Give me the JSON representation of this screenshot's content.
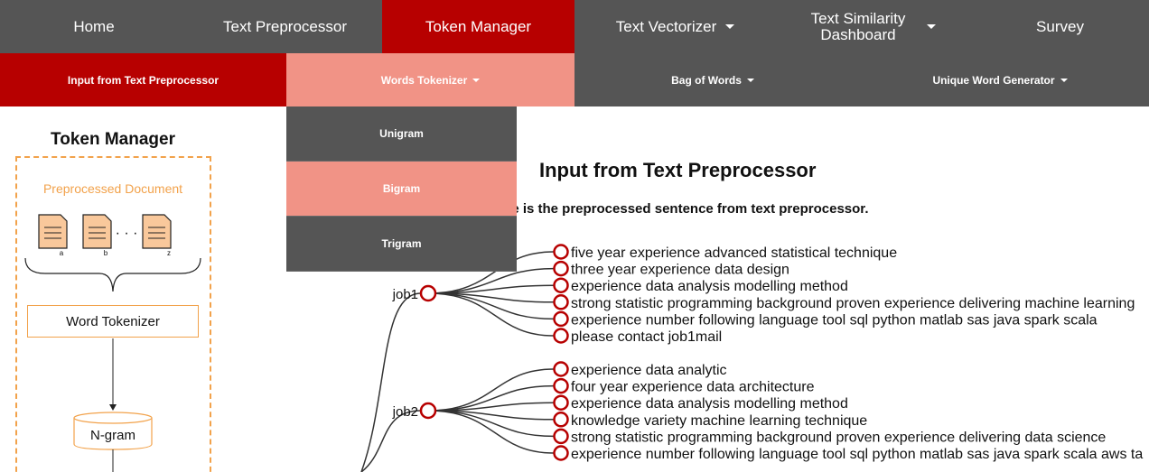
{
  "topnav": {
    "items": [
      {
        "label": "Home"
      },
      {
        "label": "Text Preprocessor"
      },
      {
        "label": "Token Manager"
      },
      {
        "label": "Text Vectorizer"
      },
      {
        "label_line1": "Text Similarity",
        "label_line2": "Dashboard"
      },
      {
        "label": "Survey"
      }
    ],
    "active_color": "#b70000",
    "bg_color": "#555555"
  },
  "subnav": {
    "items": [
      {
        "label": "Input from Text Preprocessor"
      },
      {
        "label": "Words Tokenizer"
      },
      {
        "label": "Bag of Words"
      },
      {
        "label": "Unique Word Generator"
      }
    ],
    "hover_color": "#f19386"
  },
  "dropdown": {
    "items": [
      {
        "label": "Unigram"
      },
      {
        "label": "Bigram"
      },
      {
        "label": "Trigram"
      }
    ]
  },
  "diagram": {
    "title": "Token Manager",
    "preprocessed_label": "Preprocessed Document",
    "doc_labels": [
      "a",
      "b",
      "z"
    ],
    "ellipsis": "· · ·",
    "word_tokenizer": "Word Tokenizer",
    "ngram": "N-gram",
    "accent_color": "#f2a24b"
  },
  "content": {
    "title": "Input from Text Preprocessor",
    "subtitle": "ode is the preprocessed sentence from text preprocessor."
  },
  "tree": {
    "node_color": "#b70000",
    "groups": [
      {
        "label": "job1",
        "leaves": [
          "five year experience advanced statistical technique",
          "three year experience data design",
          "experience data analysis modelling method",
          "strong statistic programming background proven experience delivering machine learning",
          "experience number following language tool sql python matlab sas java spark scala",
          "please contact job1mail"
        ]
      },
      {
        "label": "job2",
        "leaves": [
          "experience data analytic",
          "four year experience data architecture",
          "experience data analysis modelling method",
          "knowledge variety machine learning technique",
          "strong statistic programming background proven experience delivering data science",
          "experience number following language tool sql python matlab sas java spark scala aws ta"
        ]
      }
    ]
  }
}
